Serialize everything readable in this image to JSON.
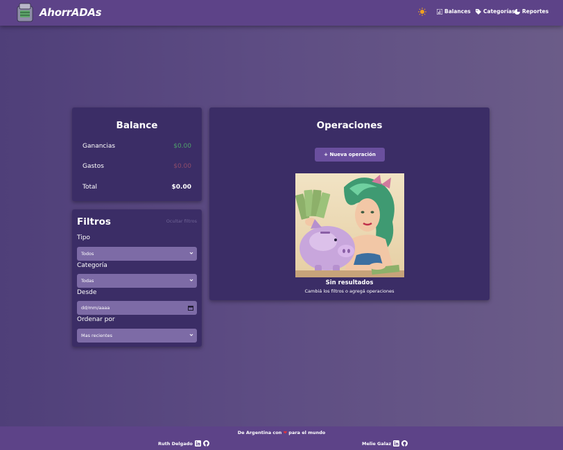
{
  "header": {
    "brand": "AhorrADAs",
    "nav": [
      {
        "label": "Balances",
        "icon": "chart-icon"
      },
      {
        "label": "Categorías",
        "icon": "tag-icon"
      },
      {
        "label": "Reportes",
        "icon": "pie-icon"
      }
    ],
    "theme_icon": "sun-icon"
  },
  "balance": {
    "title": "Balance",
    "rows": [
      {
        "label": "Ganancias",
        "value": "$0.00"
      },
      {
        "label": "Gastos",
        "value": "$0.00"
      },
      {
        "label": "Total",
        "value": "$0.00"
      }
    ]
  },
  "filters": {
    "title": "Filtros",
    "hide_label": "Ocultar filtros",
    "type_label": "Tipo",
    "type_value": "Todos",
    "category_label": "Categoría",
    "category_value": "Todas",
    "since_label": "Desde",
    "since_value": "dd/mm/aaaa",
    "order_label": "Ordenar por",
    "order_value": "Mas recientes"
  },
  "operations": {
    "title": "Operaciones",
    "new_button": "+ Nueva operación",
    "empty_title": "Sin resultados",
    "empty_subtitle": "Cambiá los filtros o agregá operaciones"
  },
  "footer": {
    "line_before": "De Argentina con",
    "line_after": "para el mundo",
    "authors": [
      "Ruth Delgado",
      "Melie Galaz"
    ]
  },
  "colors": {
    "header_bg": "#5d4388",
    "card_bg": "#3b2d66",
    "accent_button": "#6a4f9e",
    "gain": "#4fa06a",
    "loss": "#8e4b6a"
  }
}
